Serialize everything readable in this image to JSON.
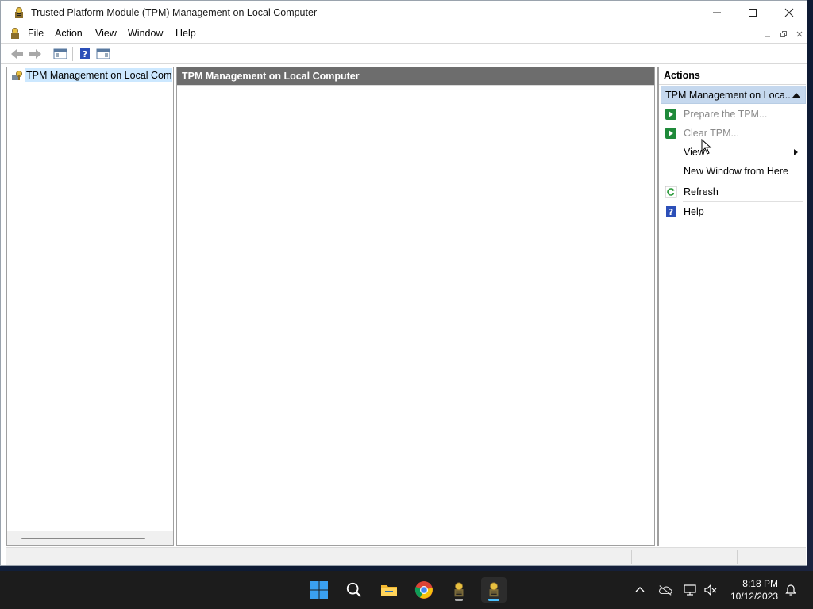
{
  "window": {
    "title": "Trusted Platform Module (TPM) Management on Local Computer"
  },
  "menubar": {
    "items": [
      "File",
      "Action",
      "View",
      "Window",
      "Help"
    ]
  },
  "tree": {
    "root_label": "TPM Management on Local Comp"
  },
  "main": {
    "header": "TPM Management on Local Computer"
  },
  "actions": {
    "title": "Actions",
    "group_label": "TPM Management on Loca...",
    "items": [
      {
        "label": "Prepare the TPM...",
        "icon": "green-arrow-icon",
        "disabled": true
      },
      {
        "label": "Clear TPM...",
        "icon": "green-arrow-icon",
        "disabled": true
      },
      {
        "label": "View",
        "icon": "",
        "submenu": true
      },
      {
        "label": "New Window from Here",
        "icon": ""
      },
      {
        "label": "Refresh",
        "icon": "refresh-icon"
      },
      {
        "label": "Help",
        "icon": "help-icon"
      }
    ]
  },
  "taskbar": {
    "time": "8:18 PM",
    "date": "10/12/2023",
    "apps": [
      "start-icon",
      "search-icon",
      "file-explorer-icon",
      "chrome-icon",
      "tpm-app-icon",
      "tpm-app-active-icon"
    ]
  },
  "colors": {
    "selection": "#cce8ff",
    "header_bg": "#6d6d6d",
    "actions_group_bg": "#c5d8ee",
    "taskbar_bg": "#1c1c1c",
    "accent": "#4cc2ff"
  }
}
